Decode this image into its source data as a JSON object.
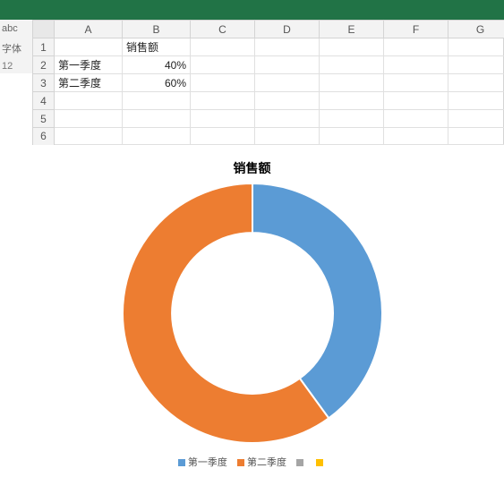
{
  "ribbon": {
    "group_label_font": "字体",
    "group_label_size": "12"
  },
  "sheet": {
    "columns": [
      "A",
      "B",
      "C",
      "D",
      "E",
      "F",
      "G"
    ],
    "row_headers": [
      "1",
      "2",
      "3",
      "4",
      "5",
      "6"
    ],
    "cells": {
      "B1": "销售额",
      "A2": "第一季度",
      "B2": "40%",
      "A3": "第二季度",
      "B3": "60%"
    }
  },
  "chart_data": {
    "type": "pie",
    "title": "销售额",
    "categories": [
      "第一季度",
      "第二季度"
    ],
    "values": [
      40,
      60
    ],
    "colors": [
      "#5B9BD5",
      "#ED7D31"
    ],
    "donut_inner": 0.62
  },
  "legend": {
    "items": [
      {
        "label": "第一季度",
        "color": "#5B9BD5"
      },
      {
        "label": "第二季度",
        "color": "#ED7D31"
      },
      {
        "label": "",
        "color": "#A5A5A5"
      },
      {
        "label": "",
        "color": "#FFC000"
      }
    ]
  }
}
